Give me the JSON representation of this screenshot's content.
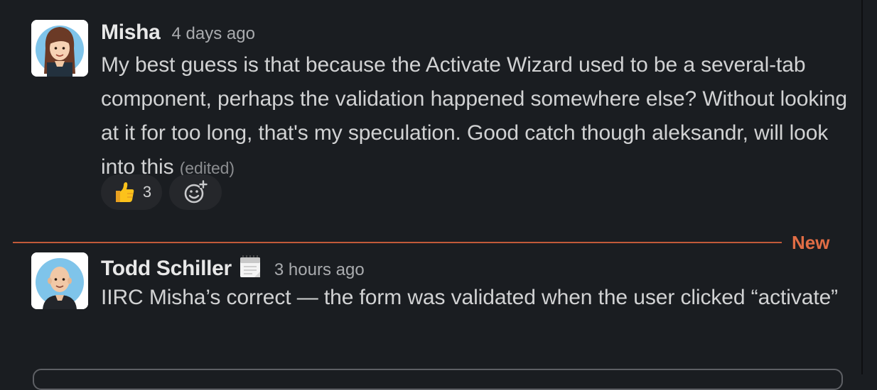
{
  "messages": [
    {
      "author": "Misha",
      "timestamp": "4 days ago",
      "text": "My best guess is that because the Activate Wizard used to be a several-tab component, perhaps the validation happened somewhere else? Without looking at it for too long, that's my speculation. Good catch though aleksandr, will look into this",
      "edited_label": "(edited)",
      "avatar_icon": "woman-avatar",
      "reactions": [
        {
          "emoji": "thumbs-up-icon",
          "count": "3"
        }
      ],
      "add_reaction_icon": "add-emoji-icon"
    },
    {
      "author": "Todd Schiller",
      "status_emoji": "calendar-icon",
      "timestamp": "3 hours ago",
      "text": "IIRC Misha’s correct — the form was validated when the user clicked “activate”",
      "avatar_icon": "bald-man-avatar"
    }
  ],
  "divider": {
    "label": "New",
    "color": "#e16d45"
  },
  "colors": {
    "background": "#1a1d21",
    "text": "#d1d2d3",
    "muted": "#a9abae",
    "reaction_bg": "#25272b"
  }
}
